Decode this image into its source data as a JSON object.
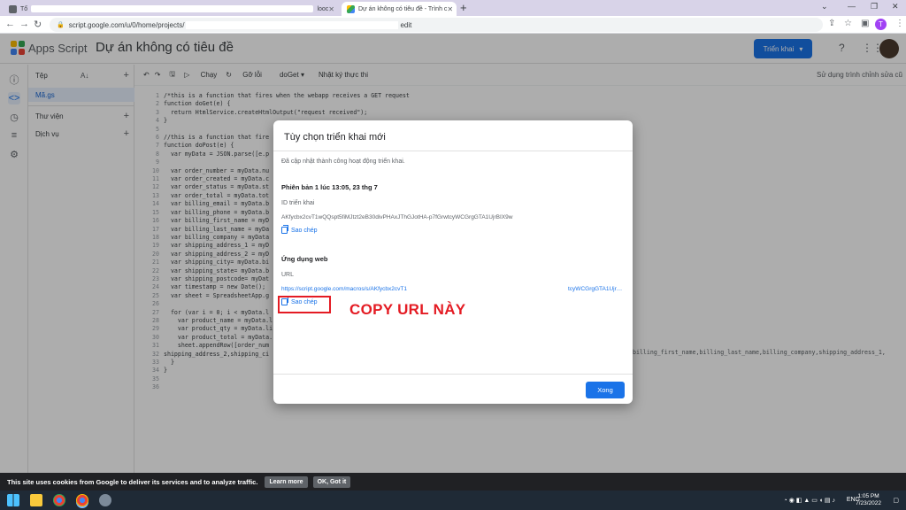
{
  "browser": {
    "tab1_title": "Tổ",
    "tab1_suffix": "looc",
    "tab2_title": "Dự án không có tiêu đề - Trình c",
    "address_prefix": "script.google.com/u/0/home/projects/",
    "address_suffix": "edit",
    "profile_initial": "T"
  },
  "app": {
    "name": "Apps Script",
    "project_title": "Dự án không có tiêu đề",
    "deploy_label": "Triển khai"
  },
  "files": {
    "header": "Tệp",
    "file_name": "Mã.gs",
    "libraries": "Thư viện",
    "services": "Dịch vụ"
  },
  "toolbar": {
    "run": "Chạy",
    "debug": "Gỡ lỗi",
    "function": "doGet",
    "log": "Nhật ký thực thi",
    "legacy_editor": "Sử dụng trình chỉnh sửa cũ"
  },
  "code": {
    "line_numbers": "1\n2\n3\n4\n5\n6\n7\n8\n9\n10\n11\n12\n13\n14\n15\n16\n17\n18\n19\n20\n21\n22\n23\n24\n25\n26\n27\n28\n29\n30\n31\n32\n33\n34\n35\n36",
    "lines": [
      "/*this is a function that fires when the webapp receives a GET request",
      "function doGet(e) {",
      "  return HtmlService.createHtmlOutput(\"request received\");",
      "}",
      "",
      "//this is a function that fire",
      "function doPost(e) {",
      "  var myData = JSON.parse([e.p",
      "",
      "  var order_number = myData.nu",
      "  var order_created = myData.c",
      "  var order_status = myData.st",
      "  var order_total = myData.tot",
      "  var billing_email = myData.b",
      "  var billing_phone = myData.b",
      "  var billing_first_name = myD",
      "  var billing_last_name = myDa",
      "  var billing_company = myData",
      "  var shipping_address_1 = myD",
      "  var shipping_address_2 = myD",
      "  var shipping_city= myData.bi",
      "  var shipping_state= myData.b",
      "  var shipping_postcode= myDat",
      "  var timestamp = new Date();",
      "  var sheet = SpreadsheetApp.g",
      "",
      "  for (var i = 0; i < myData.l",
      "    var product_name = myData.l",
      "    var product_qty = myData.li",
      "    var product_total = myData.",
      "    sheet.appendRow([order_num",
      "shipping_address_2,shipping_ci",
      "  }",
      "}",
      "",
      ""
    ],
    "overflow": "billing_first_name,billing_last_name,billing_company,shipping_address_1,"
  },
  "dialog": {
    "title": "Tùy chọn triển khai mới",
    "message": "Đã cập nhật thành công hoạt động triển khai.",
    "version": "Phiên bản 1 lúc 13:05, 23 thg 7",
    "deployment_id_label": "ID triển khai",
    "deployment_id": "AKfycbx2cvT1wQQspt5fiMJtzt2eB30divPHAxJThGJotHA-p7fGrwtcyWCGrgGTA1UjrBIX9w",
    "copy_label": "Sao chép",
    "webapp_label": "Ứng dụng web",
    "url_label": "URL",
    "url_start": "https://script.google.com/macros/s/AKfycbx2cvT1",
    "url_end": "tcyWCGrgGTA1Ujr…",
    "done_label": "Xong"
  },
  "annotation": {
    "text": "COPY URL NÀY",
    "color": "#e41b23"
  },
  "cookie": {
    "text": "This site uses cookies from Google to deliver its services and to analyze traffic.",
    "learn_more": "Learn more",
    "ok": "OK, Got it"
  },
  "taskbar": {
    "lang": "ENG",
    "time": "1:05 PM",
    "date": "7/23/2022"
  },
  "colors": {
    "accent": "#1a73e8"
  }
}
